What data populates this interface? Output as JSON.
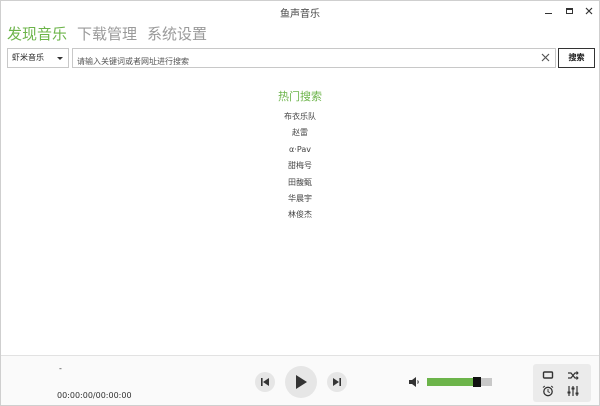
{
  "window": {
    "title": "鱼声音乐"
  },
  "tabs": [
    {
      "label": "发现音乐",
      "active": true
    },
    {
      "label": "下载管理",
      "active": false
    },
    {
      "label": "系统设置",
      "active": false
    }
  ],
  "search": {
    "source": "虾米音乐",
    "placeholder": "请输入关键词或者网址进行搜索",
    "value": "",
    "button_label": "搜索"
  },
  "hot_search": {
    "title": "热门搜索",
    "items": [
      "布衣乐队",
      "赵雷",
      "α·Pav",
      "甜梅号",
      "田馥甄",
      "华晨宇",
      "林俊杰"
    ]
  },
  "player": {
    "track": "-",
    "time": "00:00:00/00:00:00",
    "volume": 0.81
  },
  "colors": {
    "accent": "#6cb44a",
    "tab_inactive": "#9a9a9a"
  },
  "icons": {
    "prev": "skip-previous-icon",
    "play": "play-icon",
    "next": "skip-next-icon",
    "volume": "speaker-icon",
    "loop": "repeat-icon",
    "shuffle": "shuffle-icon",
    "alarm": "alarm-clock-icon",
    "eq": "equalizer-icon"
  }
}
